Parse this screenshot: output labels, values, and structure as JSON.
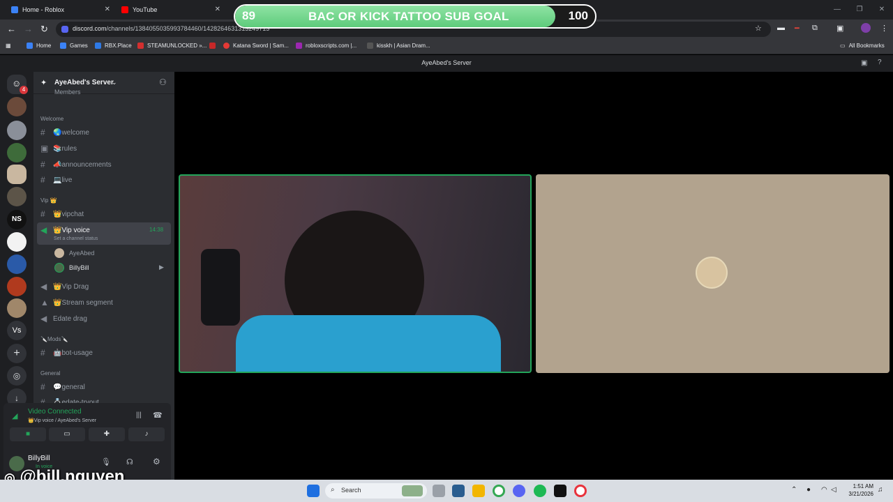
{
  "browser": {
    "tabs": [
      {
        "title": "Home - Roblox"
      },
      {
        "title": "YouTube"
      }
    ],
    "url": "discord.com/channels/1384055035993784460/1428264631313249713",
    "bookmarks": [
      "Home",
      "Games",
      "RBX.Place",
      "STEAMUNLOCKED »...",
      "Katana Sword | Sam...",
      "robloxscripts.com |...",
      "kisskh | Asian Dram..."
    ],
    "all_bookmarks": "All Bookmarks"
  },
  "goal_overlay": {
    "current": "89",
    "title": "BAC OR KICK TATTOO SUB GOAL",
    "target": "100",
    "progress_fraction": 0.89
  },
  "discord": {
    "window_title": "AyeAbed's Server",
    "notification_count": "4",
    "server_name": "AyeAbed's Server",
    "members_label": "Members",
    "categories": {
      "welcome": "Welcome",
      "vip": "Vip 👑",
      "mods": "🔪Mods🔪",
      "general": "General"
    },
    "channels": {
      "welcome": "🌏welcome",
      "rules": "📚rules",
      "announcements": "📣announcements",
      "live": "💻live",
      "vipchat": "👑vipchat",
      "vip_voice": "👑Vip voice",
      "vip_voice_time": "14:38",
      "vip_voice_status": "Set a channel status",
      "vip_drag": "👑Vip Drag",
      "stream_segment": "👑Stream segment",
      "edate_drag": "Edate drag",
      "bot_usage": "🤖bot-usage",
      "general": "💬general",
      "edate_tryout": "💍edate-tryout"
    },
    "voice_members": [
      "AyeAbed",
      "BillyBill"
    ],
    "voice_panel": {
      "status": "Video Connected",
      "channel": "👑Vip voice / AyeAbed's Server"
    },
    "user": {
      "name": "BillyBill",
      "status": "In voice"
    }
  },
  "taskbar": {
    "search_placeholder": "Search",
    "time": "1:51 AM",
    "date": "3/21/2026"
  },
  "watermark": "@bill.nguyen"
}
